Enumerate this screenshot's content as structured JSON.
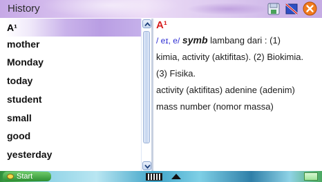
{
  "window": {
    "title": "History"
  },
  "toolbar": {
    "icons": [
      "save-icon",
      "flag-icon",
      "close-icon"
    ],
    "close_color": "#f07a1e"
  },
  "history_list": {
    "items": [
      {
        "label": "A¹",
        "selected": true
      },
      {
        "label": "mother"
      },
      {
        "label": "Monday"
      },
      {
        "label": "today"
      },
      {
        "label": "student"
      },
      {
        "label": "small"
      },
      {
        "label": "good"
      },
      {
        "label": "yesterday"
      }
    ]
  },
  "definition": {
    "headword": "A¹",
    "pronunciation": "/ eɪ, e/",
    "part_of_speech": "symb",
    "line1_rest": "lambang dari : (1)",
    "line2": "kimia, activity (aktifitas). (2) Biokimia.",
    "line3": "(3) Fisika.",
    "line4": "activity (aktifitas) adenine (adenim)",
    "line5": "mass number (nomor massa)"
  },
  "taskbar": {
    "start_label": "Start"
  },
  "colors": {
    "accent_purple": "#b99ee3",
    "headword_red": "#d81e1e",
    "pronunciation_blue": "#2b2bd2"
  }
}
